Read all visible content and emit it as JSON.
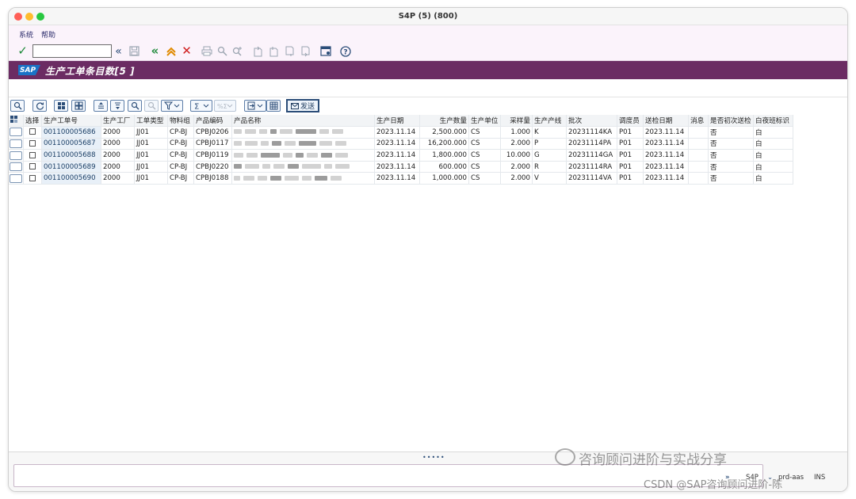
{
  "window": {
    "title": "S4P (5) (800)"
  },
  "menu": {
    "items": [
      "系统",
      "帮助"
    ]
  },
  "toolbar": {
    "command_value": ""
  },
  "header": {
    "title": "生产工单条目数[5 ]"
  },
  "alv": {
    "send_label": "发送"
  },
  "table": {
    "columns": [
      "选择",
      "生产工单号",
      "生产工厂",
      "工单类型",
      "物料组",
      "产品编码",
      "产品名称",
      "生产日期",
      "生产数量",
      "生产单位",
      "采样量",
      "生产产线",
      "批次",
      "调度员",
      "送检日期",
      "消息",
      "是否初次送检",
      "白夜班标识"
    ],
    "rows": [
      {
        "order": "001100005686",
        "plant": "2000",
        "type": "JJ01",
        "group": "CP-BJ",
        "code": "CPBJ0206",
        "date": "2023.11.14",
        "qty": "2,500.000",
        "unit": "CS",
        "sample": "1.000",
        "line": "K",
        "batch": "20231114KA",
        "dispatcher": "P01",
        "inspect": "2023.11.14",
        "msg": "",
        "first": "否",
        "shift": "白"
      },
      {
        "order": "001100005687",
        "plant": "2000",
        "type": "JJ01",
        "group": "CP-BJ",
        "code": "CPBJ0117",
        "date": "2023.11.14",
        "qty": "16,200.000",
        "unit": "CS",
        "sample": "2.000",
        "line": "P",
        "batch": "20231114PA",
        "dispatcher": "P01",
        "inspect": "2023.11.14",
        "msg": "",
        "first": "否",
        "shift": "白"
      },
      {
        "order": "001100005688",
        "plant": "2000",
        "type": "JJ01",
        "group": "CP-BJ",
        "code": "CPBJ0119",
        "date": "2023.11.14",
        "qty": "1,800.000",
        "unit": "CS",
        "sample": "10.000",
        "line": "G",
        "batch": "20231114GA",
        "dispatcher": "P01",
        "inspect": "2023.11.14",
        "msg": "",
        "first": "否",
        "shift": "白"
      },
      {
        "order": "001100005689",
        "plant": "2000",
        "type": "JJ01",
        "group": "CP-BJ",
        "code": "CPBJ0220",
        "date": "2023.11.14",
        "qty": "600.000",
        "unit": "CS",
        "sample": "2.000",
        "line": "R",
        "batch": "20231114RA",
        "dispatcher": "P01",
        "inspect": "2023.11.14",
        "msg": "",
        "first": "否",
        "shift": "白"
      },
      {
        "order": "001100005690",
        "plant": "2000",
        "type": "JJ01",
        "group": "CP-BJ",
        "code": "CPBJ0188",
        "date": "2023.11.14",
        "qty": "1,000.000",
        "unit": "CS",
        "sample": "2.000",
        "line": "V",
        "batch": "20231114VA",
        "dispatcher": "P01",
        "inspect": "2023.11.14",
        "msg": "",
        "first": "否",
        "shift": "白"
      }
    ]
  },
  "status": {
    "system": "S4P",
    "host": "prd-aas",
    "mode": "INS"
  },
  "watermark": {
    "line1": "咨询顾问进阶与实战分享",
    "line2": "CSDN @SAP咨询顾问进阶-陈"
  },
  "colors": {
    "title_band": "#6b2c63",
    "menu_bg": "#fbf3fb",
    "accent_blue": "#2b4d78"
  }
}
